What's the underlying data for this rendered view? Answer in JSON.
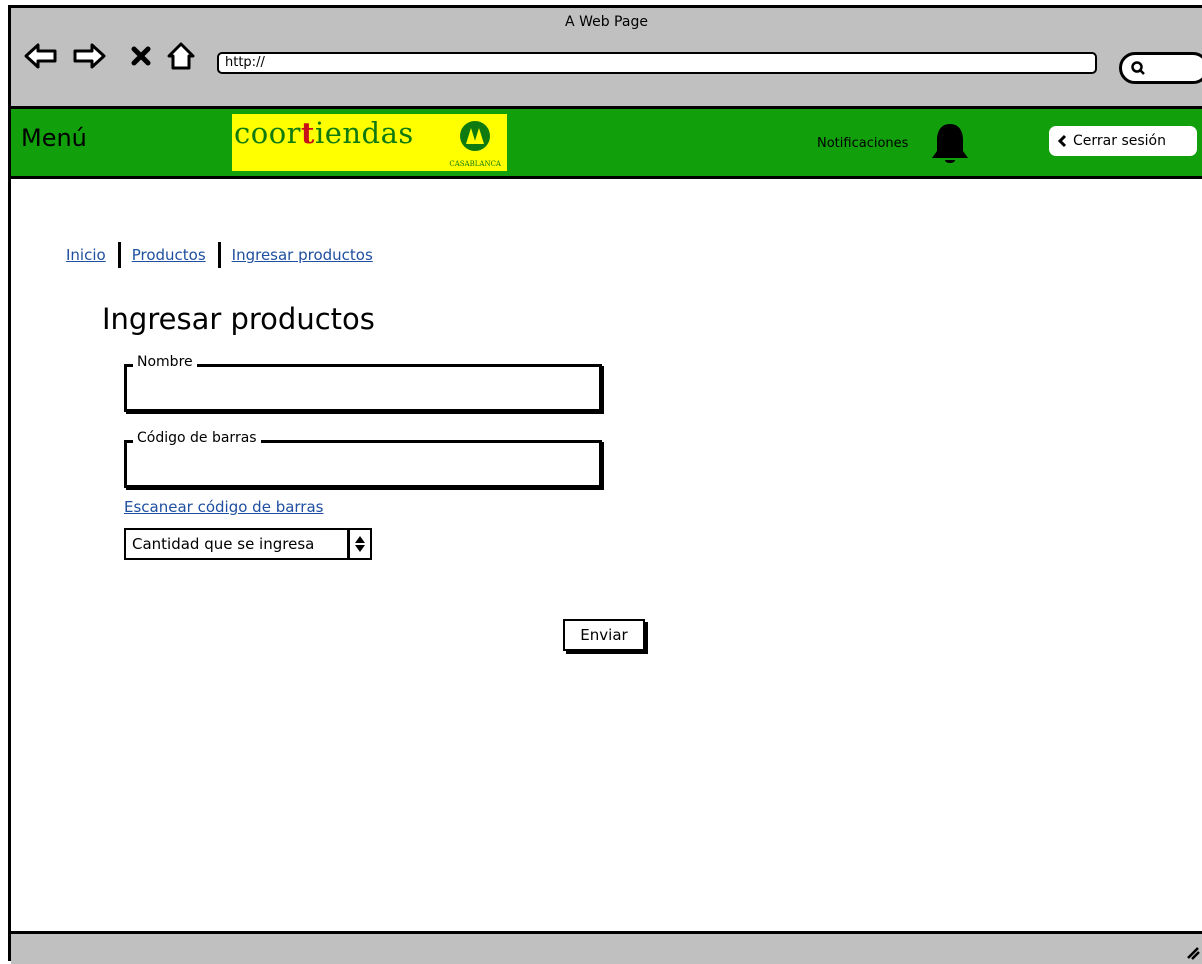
{
  "browser": {
    "title": "A Web Page",
    "address": "http://"
  },
  "header": {
    "menu_label": "Menú",
    "logo": {
      "wordmark_pre": "coor",
      "wordmark_t": "t",
      "wordmark_post": "iendas",
      "subtitle": "CASABLANCA"
    },
    "notifications_label": "Notificaciones",
    "logout_label": "Cerrar sesión",
    "brand_color": "#11a00c",
    "logo_bg_color": "#ffff00"
  },
  "breadcrumb": [
    "Inicio",
    "Productos",
    "Ingresar productos"
  ],
  "form": {
    "title": "Ingresar productos",
    "name_label": "Nombre",
    "name_value": "",
    "barcode_label": "Código de barras",
    "barcode_value": "",
    "scan_link": "Escanear código de barras",
    "quantity_value": "Cantidad que se ingresa",
    "submit_label": "Enviar"
  },
  "link_color": "#1f4fa0"
}
